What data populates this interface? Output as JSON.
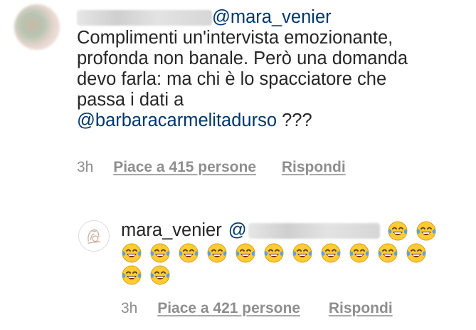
{
  "comment_1": {
    "mention": "@mara_venier",
    "lines": [
      "Complimenti un'intervista emozionante,",
      "profonda non banale. Però una domanda",
      "devo farla: ma chi è lo spacciatore che",
      "passa i dati a"
    ],
    "last_line_mention": "@barbaracarmelitadurso",
    "last_line_suffix": " ???",
    "time": "3h",
    "likes_label": "Piace a 415 persone",
    "reply_label": "Rispondi"
  },
  "comment_2": {
    "username": "mara_venier",
    "mention_prefix": "@",
    "emoji_name": "face-with-tears-of-joy",
    "emoji_count": 15,
    "time": "3h",
    "likes_label": "Piace a 421 persone",
    "reply_label": "Rispondi"
  },
  "colors": {
    "text": "#262626",
    "mention": "#00376b",
    "meta": "#8e8e8e",
    "emoji_face": "#ffcc33",
    "emoji_tear": "#4aa8e8"
  }
}
